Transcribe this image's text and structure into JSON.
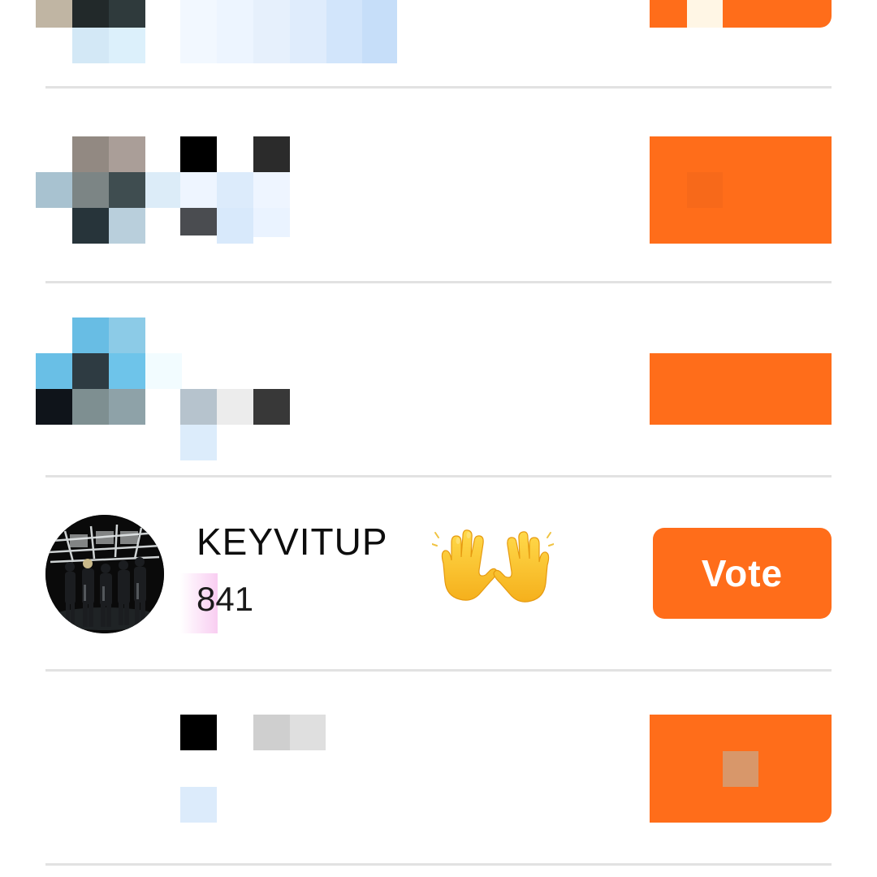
{
  "colors": {
    "accent": "#ff6d1a",
    "divider": "#e2e2e2"
  },
  "rows": [
    {
      "state": "pixelated"
    },
    {
      "state": "pixelated"
    },
    {
      "state": "pixelated"
    },
    {
      "state": "visible",
      "name": "KEYVITUP",
      "count": "841",
      "reaction_icon": "raised-hands-icon",
      "vote_label": "Vote",
      "avatar_icon": "group-photo-avatar"
    },
    {
      "state": "pixelated"
    }
  ]
}
